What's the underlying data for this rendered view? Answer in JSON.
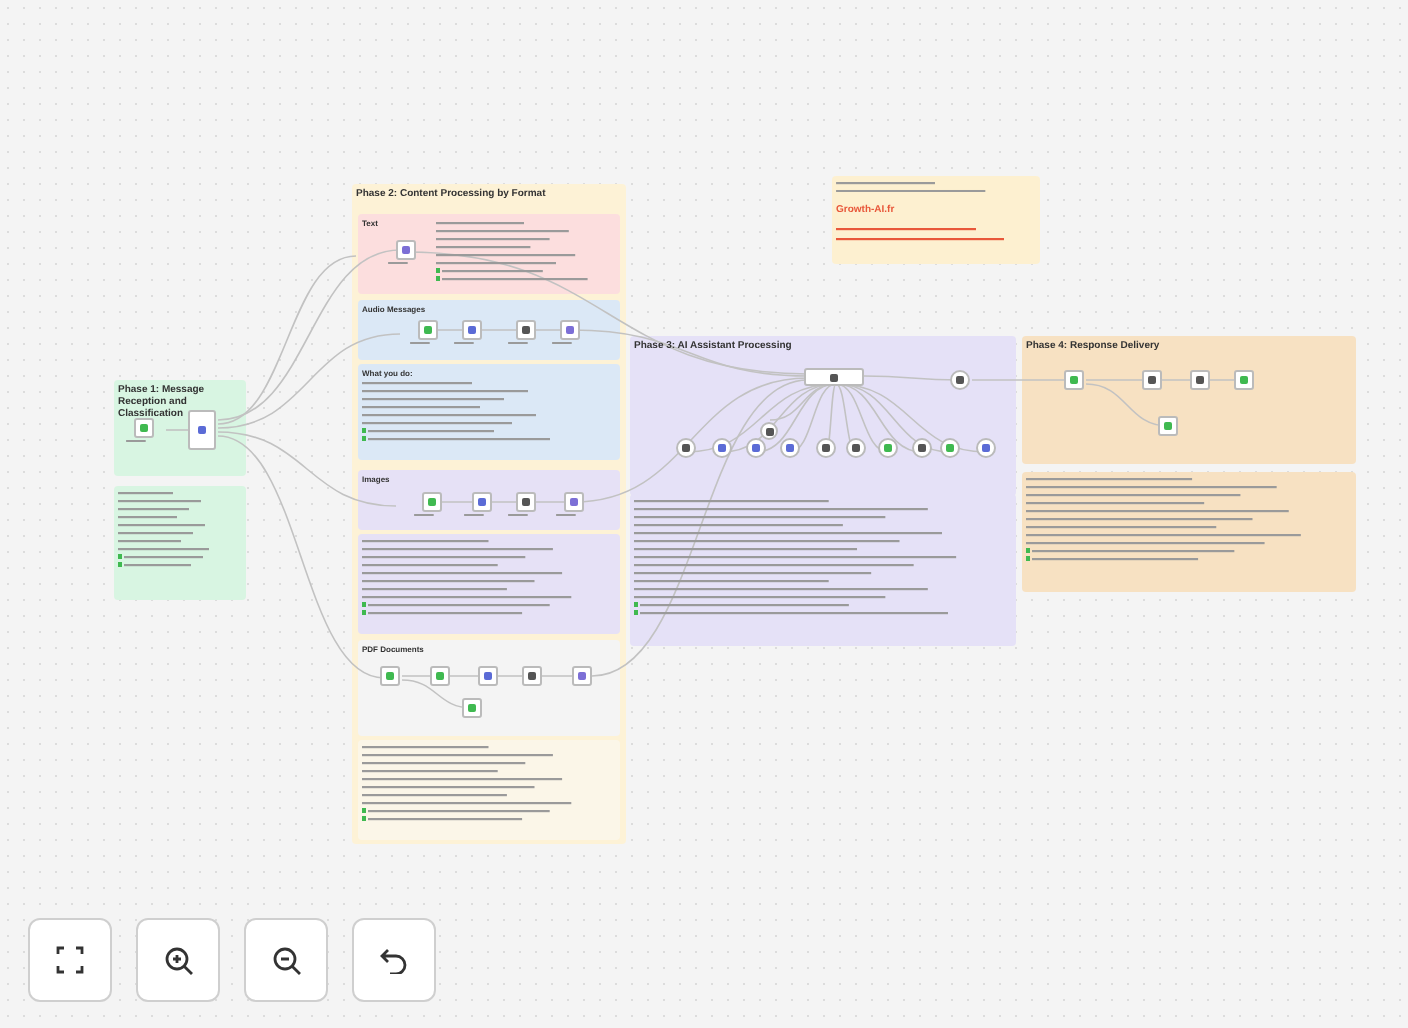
{
  "phases": [
    {
      "title": "Phase 1: Message Reception and Classification",
      "color": "#d8f5e2"
    },
    {
      "title": "Phase 2: Content Processing by Format",
      "color": "#fdf2d6"
    },
    {
      "title": "Phase 3: AI Assistant Processing",
      "color": "#e5e1f7"
    },
    {
      "title": "Phase 4: Response Delivery",
      "color": "#f7e1c2"
    }
  ],
  "sections": [
    {
      "title": "Text",
      "color": "#fcdede"
    },
    {
      "title": "Audio Messages",
      "color": "#dbe8f6"
    },
    {
      "title": "What you do:",
      "color": "#dbe8f6"
    },
    {
      "title": "Images",
      "color": "#e6e1f6"
    },
    {
      "title": "PDF Documents",
      "color": "#f4f4f4"
    }
  ],
  "sticky": {
    "brand": "Growth-AI.fr"
  }
}
